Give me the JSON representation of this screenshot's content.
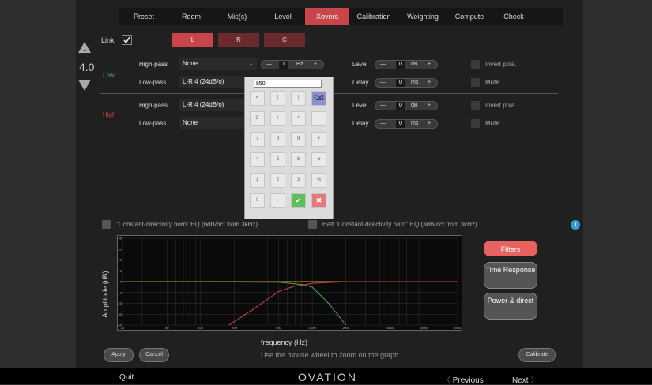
{
  "menu": {
    "items": [
      "Preset",
      "Room",
      "Mic(s)",
      "Level",
      "Xovers",
      "Calibration",
      "Weighting",
      "Compute",
      "Check"
    ],
    "active_index": 4
  },
  "link": {
    "label": "Link",
    "checked": true
  },
  "channels": {
    "tabs": [
      "L",
      "R",
      "C"
    ],
    "active": "L"
  },
  "left_panel": {
    "up_icon": "+",
    "value": "4.0"
  },
  "low": {
    "group_label": "Low",
    "highpass": {
      "label": "High-pass",
      "value": "None",
      "freq": "1",
      "freq_unit": "Hz"
    },
    "lowpass": {
      "label": "Low-pass",
      "value": "L-R 4 (24dB/o)"
    },
    "level": {
      "label": "Level",
      "value": "0",
      "unit": "dB"
    },
    "delay": {
      "label": "Delay",
      "value": "0",
      "unit": "ms"
    },
    "invert_label": "Invert pola.",
    "mute_label": "Mute"
  },
  "high": {
    "group_label": "High",
    "highpass": {
      "label": "High-pass",
      "value": "L-R 4 (24dB/o)"
    },
    "lowpass": {
      "label": "Low-pass",
      "value": "None"
    },
    "level": {
      "label": "Level",
      "value": "0",
      "unit": "dB"
    },
    "delay": {
      "label": "Delay",
      "value": "0",
      "unit": "ms"
    },
    "invert_label": "Invert pola.",
    "mute_label": "Mute"
  },
  "keypad": {
    "input_value": "850",
    "keys": [
      "=",
      "(",
      ")",
      "⌫",
      "C",
      "/",
      "*",
      "-",
      "7",
      "8",
      "9",
      "+",
      "4",
      "5",
      "6",
      "±",
      "1",
      "2",
      "3",
      "%",
      "0",
      ".",
      "✔",
      "✖"
    ]
  },
  "eq_options": {
    "cd_horn": "\"Constant-directivity horn\" EQ (6dB/oct from 3kHz)",
    "half_cd_horn": "Half \"Constant-directivity horn\" EQ (3dB/oct from 3kHz)"
  },
  "side_buttons": {
    "filters": "Filters",
    "time": "Time Response",
    "power": "Power & direct"
  },
  "bottom": {
    "apply": "Apply",
    "cancel": "Cancel",
    "hint": "Use the mouse wheel to zoom on the graph",
    "calibrate": "Calibrate",
    "quit": "Quit",
    "brand": "OVATION",
    "previous": "Previous",
    "next": "Next"
  },
  "chart_data": {
    "type": "line",
    "xlabel": "frequency (Hz)",
    "ylabel": "Amplitude (dB)",
    "x_scale": "log",
    "xlim": [
      20,
      20000
    ],
    "ylim": [
      -40,
      40
    ],
    "x_ticks": [
      20,
      50,
      100,
      200,
      500,
      1000,
      2000,
      5000,
      10000,
      20000
    ],
    "y_ticks": [
      40,
      30,
      20,
      10,
      0,
      -10,
      -20,
      -30,
      -40
    ],
    "grid": true,
    "series": [
      {
        "color": "#e0a030",
        "x": [
          20,
          20000
        ],
        "y": [
          0,
          0
        ]
      },
      {
        "color": "#4caf50",
        "x": [
          20,
          500,
          700,
          850,
          1000,
          1400,
          2000
        ],
        "y": [
          0,
          -0.5,
          -2,
          -3,
          -5,
          -20,
          -40
        ]
      },
      {
        "color": "#d64545",
        "x": [
          180,
          300,
          500,
          700,
          850,
          1000,
          2000,
          20000
        ],
        "y": [
          -40,
          -25,
          -9,
          -4,
          -3,
          -1.5,
          0,
          0
        ]
      }
    ]
  },
  "colors": {
    "accent": "#c9454a",
    "info": "#2f9fd6"
  }
}
